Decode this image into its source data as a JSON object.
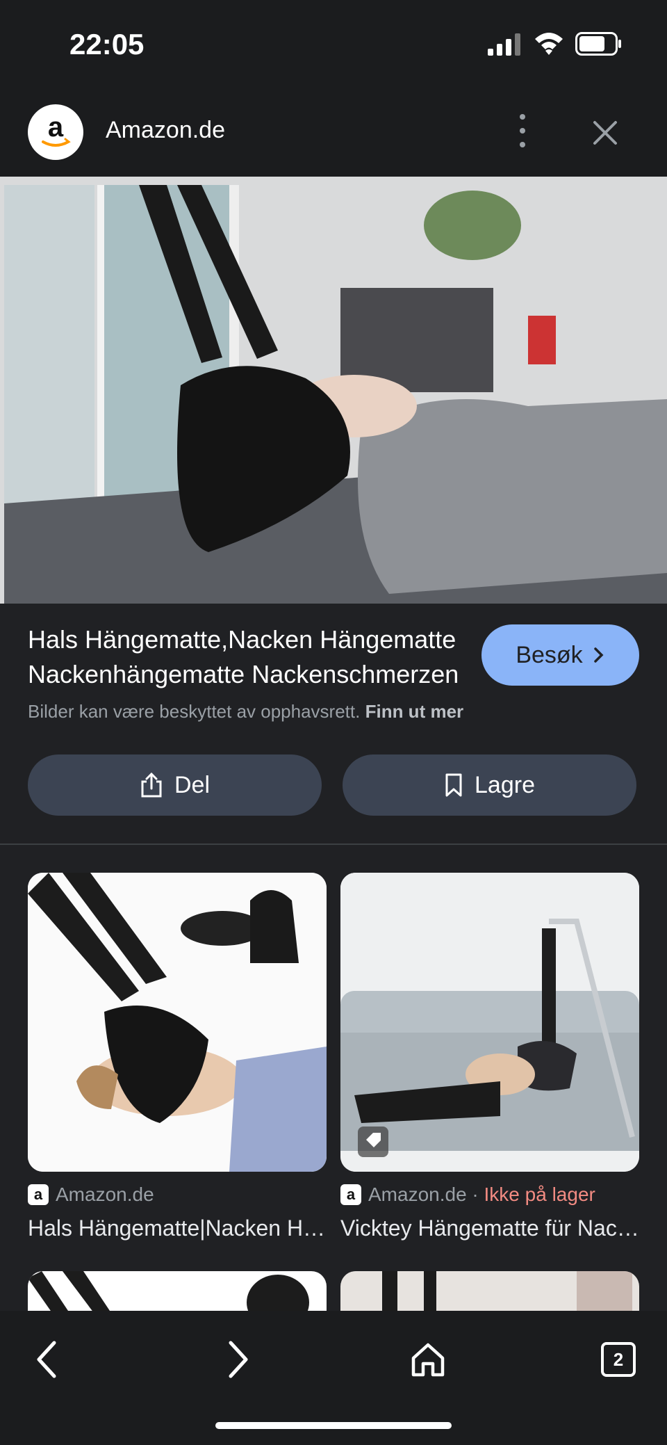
{
  "status_bar": {
    "time": "22:05"
  },
  "header": {
    "site_name": "Amazon.de",
    "logo_letter": "a"
  },
  "result": {
    "title": "Hals Hängematte,Nacken Hängematte Nackenhängematte Nackenschmerzen",
    "copyright_text": "Bilder kan være beskyttet av opphavsrett.",
    "learn_more": "Finn ut mer",
    "visit_label": "Besøk"
  },
  "actions": {
    "share_label": "Del",
    "save_label": "Lagre"
  },
  "related": [
    {
      "source": "Amazon.de",
      "stock": "",
      "title": "Hals Hängematte|Nacken Hängematte"
    },
    {
      "source": "Amazon.de",
      "stock": "Ikke på lager",
      "title": "Vicktey Hängematte für Nacken"
    }
  ],
  "related_separator": " · ",
  "bottom_nav": {
    "tab_count": "2"
  },
  "colors": {
    "accent": "#8ab4f8",
    "background": "#202124",
    "warning": "#f28b82"
  },
  "icons": [
    "signal-icon",
    "wifi-icon",
    "battery-icon",
    "more-vert-icon",
    "close-icon",
    "chevron-right-icon",
    "share-icon",
    "bookmark-icon",
    "tag-icon",
    "back-icon",
    "forward-icon",
    "home-icon",
    "tabs-icon"
  ]
}
